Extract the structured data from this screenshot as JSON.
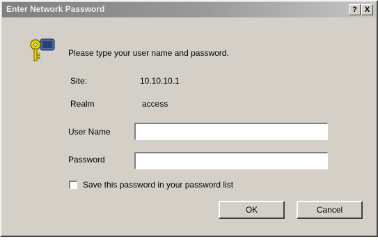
{
  "window": {
    "title": "Enter Network Password",
    "help_button": "?",
    "close_button": "X"
  },
  "icons": {
    "main": "key-icon"
  },
  "prompt": "Please type your user name and password.",
  "site": {
    "label": "Site:",
    "value": "10.10.10.1"
  },
  "realm": {
    "label": "Realm",
    "value": "access"
  },
  "username": {
    "label": "User Name",
    "value": ""
  },
  "password": {
    "label": "Password",
    "value": ""
  },
  "save_password": {
    "label": "Save this password in your password list",
    "checked": false
  },
  "buttons": {
    "ok": "OK",
    "cancel": "Cancel"
  },
  "colors": {
    "dialog_bg": "#d4d0c8",
    "titlebar_start": "#7f7f7f",
    "titlebar_end": "#c6c6c6",
    "key_yellow": "#e8d800"
  }
}
